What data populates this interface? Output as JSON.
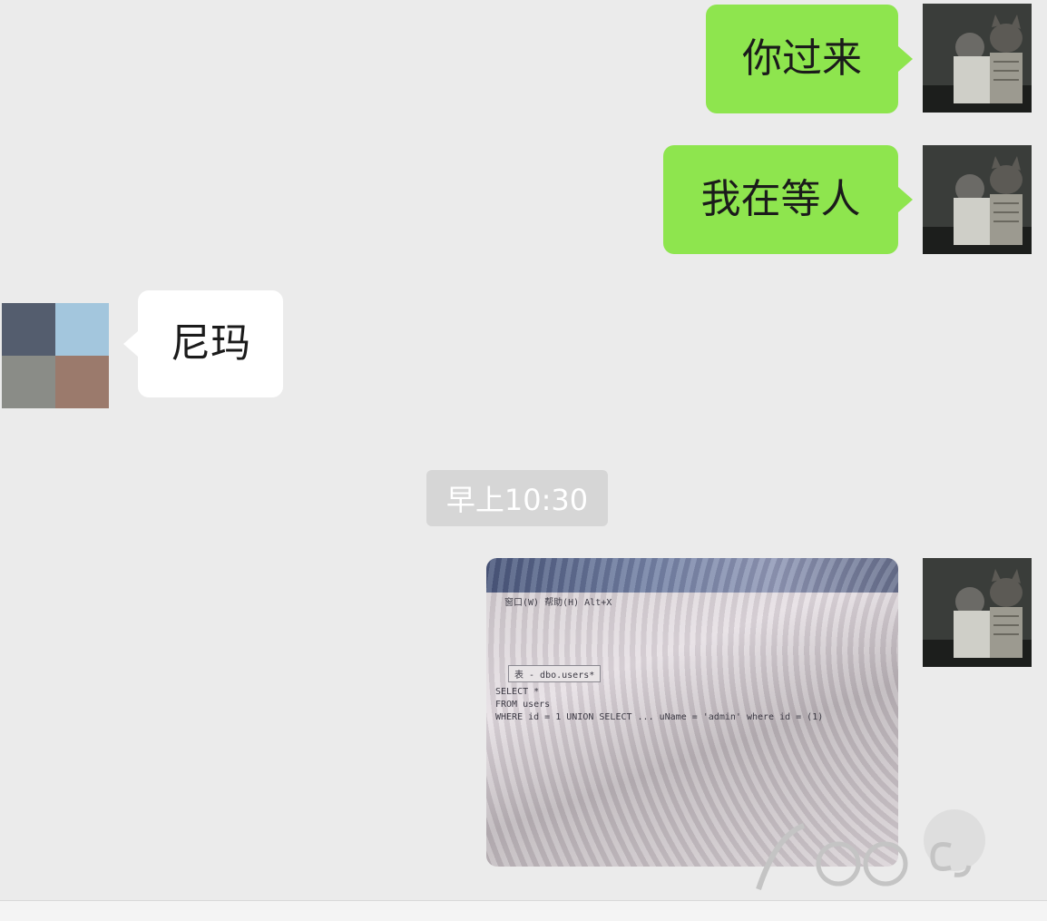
{
  "messages": [
    {
      "direction": "outgoing",
      "text": "你过来"
    },
    {
      "direction": "outgoing",
      "text": "我在等人"
    },
    {
      "direction": "incoming",
      "text": "尼玛"
    }
  ],
  "timestamp": "早上10:30",
  "image_message": {
    "direction": "outgoing",
    "content": "photo-of-sql-query-screen",
    "menu_text": "窗口(W)   帮助(H)   Alt+X",
    "tab_text": "表 - dbo.users*",
    "sql_lines": [
      "SELECT    *",
      "FROM        users",
      "WHERE    id = 1 UNION SELECT ... uName = 'admin' where id = (1)"
    ]
  },
  "colors": {
    "background": "#ebebeb",
    "outgoing_bubble": "#8ee54e",
    "incoming_bubble": "#ffffff",
    "timestamp_bg": "#d6d6d6"
  },
  "avatars": {
    "self": "cat-and-child-photo-avatar",
    "other": "pixelated-avatar"
  },
  "watermark": "site-logo-watermark"
}
